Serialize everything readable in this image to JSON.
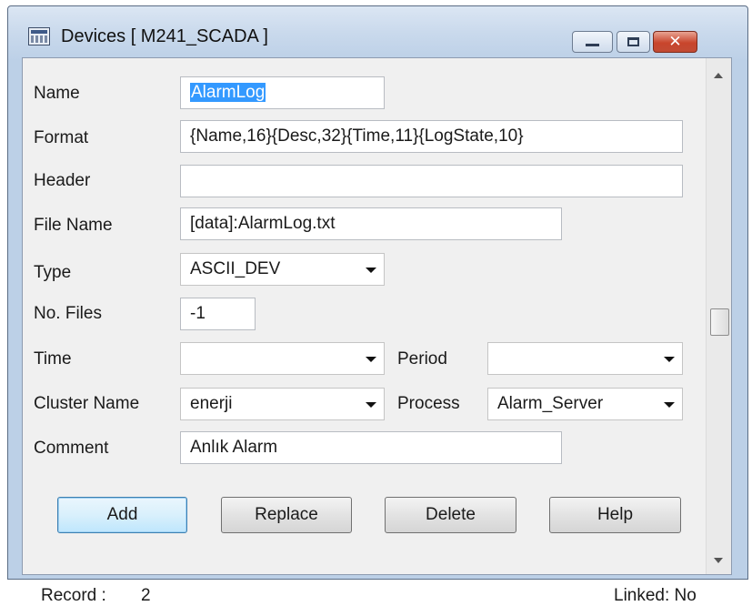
{
  "window": {
    "title": "Devices [ M241_SCADA ]",
    "close_glyph": "✕"
  },
  "form": {
    "name": {
      "label": "Name",
      "value": "AlarmLog"
    },
    "format": {
      "label": "Format",
      "value": "{Name,16}{Desc,32}{Time,11}{LogState,10}"
    },
    "header": {
      "label": "Header",
      "value": ""
    },
    "file_name": {
      "label": "File Name",
      "value": "[data]:AlarmLog.txt"
    },
    "type": {
      "label": "Type",
      "value": "ASCII_DEV"
    },
    "no_files": {
      "label": "No. Files",
      "value": "-1"
    },
    "time": {
      "label": "Time",
      "value": ""
    },
    "period": {
      "label": "Period",
      "value": ""
    },
    "cluster_name": {
      "label": "Cluster Name",
      "value": "enerji"
    },
    "process": {
      "label": "Process",
      "value": "Alarm_Server"
    },
    "comment": {
      "label": "Comment",
      "value": "Anlık Alarm"
    }
  },
  "buttons": {
    "add": "Add",
    "replace": "Replace",
    "delete": "Delete",
    "help": "Help"
  },
  "status": {
    "record_label": "Record :",
    "record_value": "2",
    "linked": "Linked: No"
  },
  "colors": {
    "selection": "#3399ff",
    "close_button": "#c8452c"
  }
}
